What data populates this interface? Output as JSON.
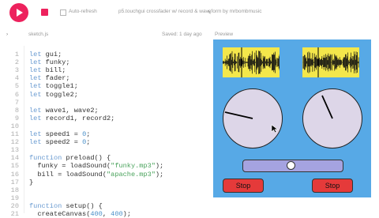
{
  "toolbar": {
    "auto_refresh_label": "Auto-refresh",
    "sketch_title": "p5.touchgui crossfader w/ record & waveform",
    "author": "by mrbombmusic"
  },
  "editor": {
    "file_name": "sketch.js",
    "saved_status": "Saved: 1 day ago",
    "preview_label": "Preview",
    "lines": [
      {
        "n": "1",
        "t": "let gui;"
      },
      {
        "n": "2",
        "t": "let funky;"
      },
      {
        "n": "3",
        "t": "let bill;"
      },
      {
        "n": "4",
        "t": "let fader;"
      },
      {
        "n": "5",
        "t": "let toggle1;"
      },
      {
        "n": "6",
        "t": "let toggle2;"
      },
      {
        "n": "7",
        "t": ""
      },
      {
        "n": "8",
        "t": "let wave1, wave2;"
      },
      {
        "n": "9",
        "t": "let record1, record2;"
      },
      {
        "n": "10",
        "t": ""
      },
      {
        "n": "11",
        "t": "let speed1 = 0;"
      },
      {
        "n": "12",
        "t": "let speed2 = 0;"
      },
      {
        "n": "13",
        "t": ""
      },
      {
        "n": "14",
        "t": "function preload() {"
      },
      {
        "n": "15",
        "t": "  funky = loadSound(\"funky.mp3\");"
      },
      {
        "n": "16",
        "t": "  bill = loadSound(\"apache.mp3\");"
      },
      {
        "n": "17",
        "t": "}"
      },
      {
        "n": "18",
        "t": ""
      },
      {
        "n": "19",
        "t": ""
      },
      {
        "n": "20",
        "t": "function setup() {"
      },
      {
        "n": "21",
        "t": "  createCanvas(400, 400);"
      }
    ]
  },
  "preview": {
    "stop_left": "Stop",
    "stop_right": "Stop",
    "fader_level": 0.5
  },
  "colors": {
    "accent": "#ed225d",
    "canvas_bg": "#57a9e6",
    "wave_bg": "#f4e74b",
    "dial_bg": "#ddd6e8",
    "stop_bg": "#e53a3a",
    "slider_bg": "#a5a3e0"
  }
}
